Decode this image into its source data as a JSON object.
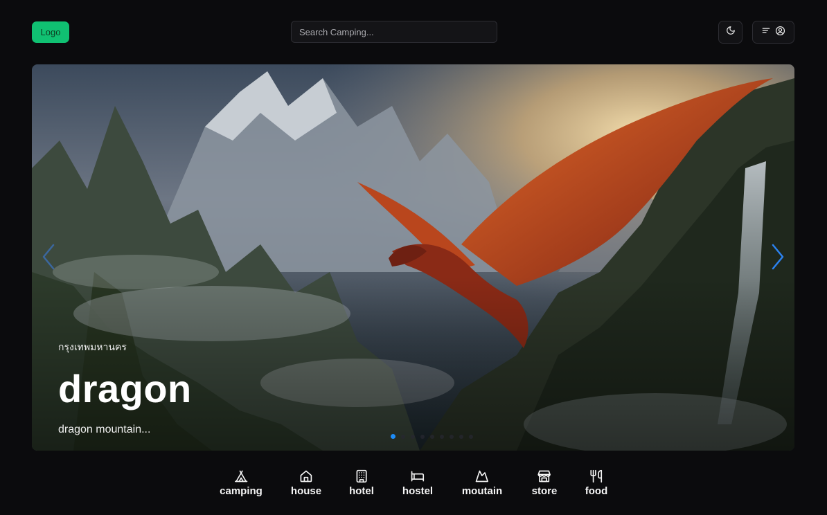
{
  "header": {
    "logo_label": "Logo",
    "search_placeholder": "Search Camping...",
    "theme_icon": "moon-icon",
    "menu_icons": [
      "menu-lines-icon",
      "user-circle-icon"
    ]
  },
  "hero": {
    "location": "กรุงเทพมหานคร",
    "title": "dragon",
    "description": "dragon mountain...",
    "active_slide": 1,
    "slide_count": 9,
    "image_alt": "red dragon flying over misty mountains with waterfall"
  },
  "categories": [
    {
      "label": "camping",
      "icon": "tent-icon"
    },
    {
      "label": "house",
      "icon": "house-icon"
    },
    {
      "label": "hotel",
      "icon": "hotel-icon"
    },
    {
      "label": "hostel",
      "icon": "bed-icon"
    },
    {
      "label": "moutain",
      "icon": "mountain-icon"
    },
    {
      "label": "store",
      "icon": "store-icon"
    },
    {
      "label": "food",
      "icon": "utensils-icon"
    }
  ],
  "colors": {
    "background": "#0b0b0d",
    "logo": "#10c172",
    "accent": "#1d8cf8"
  }
}
